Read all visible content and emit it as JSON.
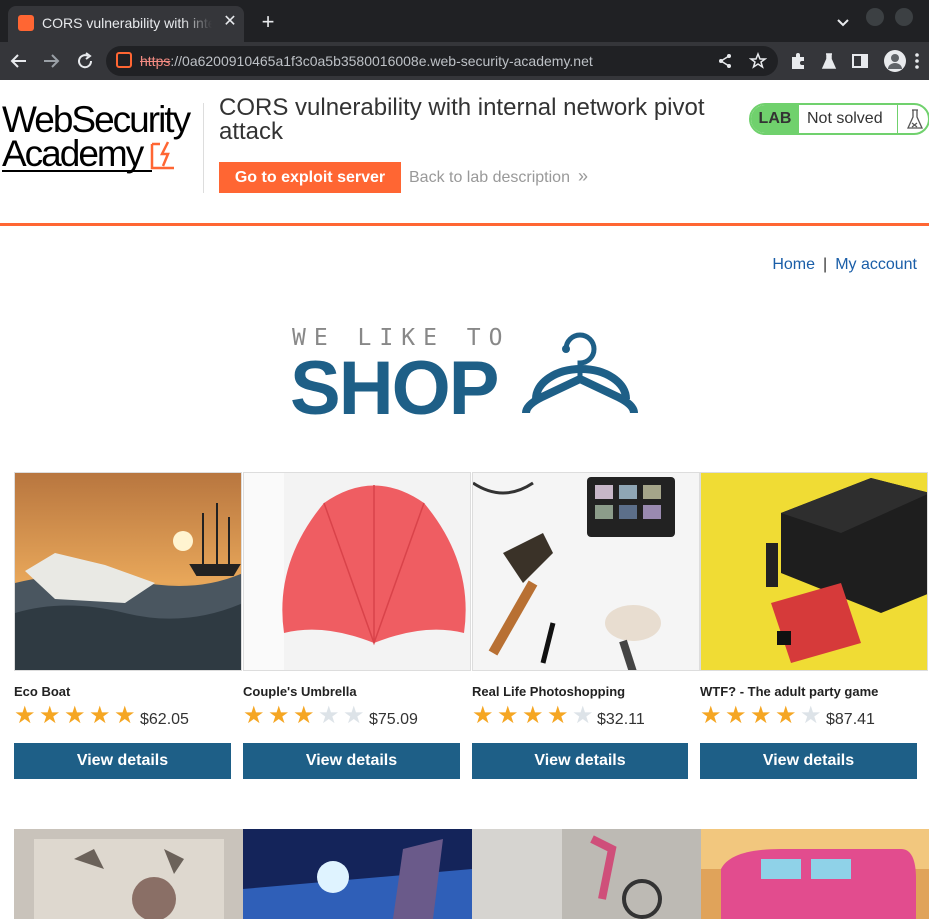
{
  "browser": {
    "tab_title": "CORS vulnerability with internal network pivot attack",
    "tab_close": "✕",
    "new_tab": "+",
    "url_scheme": "https",
    "url_rest": "://0a6200910465a1f3c0a5b3580016008e.web-security-academy.net"
  },
  "header": {
    "logo_line1": "WebSecurity",
    "logo_line2": "Academy",
    "lab_title": "CORS vulnerability with internal network pivot attack",
    "exploit_button": "Go to exploit server",
    "back_link": "Back to lab description",
    "back_chevron": "»",
    "lab_badge": "LAB",
    "lab_status": "Not solved",
    "lab_flask": "⚗",
    "accent_color": "#ff6633",
    "status_color": "#70d16d"
  },
  "nav": {
    "home": "Home",
    "separator": "|",
    "my_account": "My account"
  },
  "banner": {
    "small_text": "WE LIKE TO",
    "big_text": "SHOP",
    "brand_color": "#1e5f87"
  },
  "products": [
    {
      "name": "Eco Boat",
      "rating": 5,
      "price": "$62.05",
      "button": "View details"
    },
    {
      "name": "Couple's Umbrella",
      "rating": 3,
      "price": "$75.09",
      "button": "View details"
    },
    {
      "name": "Real Life Photoshopping",
      "rating": 4,
      "price": "$32.11",
      "button": "View details"
    },
    {
      "name": "WTF? - The adult party game",
      "rating": 4,
      "price": "$87.41",
      "button": "View details"
    }
  ],
  "icons": {
    "back": "arrow-left-icon",
    "forward": "arrow-right-icon",
    "reload": "reload-icon",
    "share": "share-icon",
    "bookmark": "star-icon",
    "extensions": "puzzle-icon",
    "labs": "flask-icon",
    "sidepanel": "side-panel-icon",
    "profile": "profile-icon",
    "menu": "kebab-menu-icon"
  }
}
